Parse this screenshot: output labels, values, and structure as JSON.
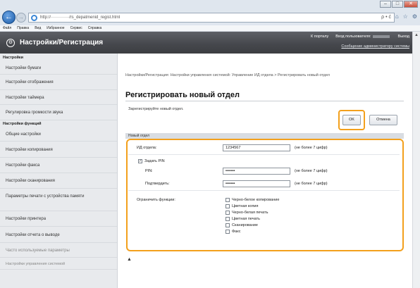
{
  "browser": {
    "url": "http://·············/rs_depatmenid_regist.html",
    "addr_right": "ρ • ć",
    "menu": [
      "Файл",
      "Правка",
      "Вид",
      "Избранное",
      "Сервис",
      "Справка"
    ]
  },
  "header": {
    "title": "Настройки/Регистрация",
    "portal_link": "К порталу",
    "login_label": "Вход пользователя:",
    "logout": "Выход",
    "admin_message": "Сообщение администратору системы"
  },
  "sidebar": {
    "section1": "Настройки",
    "items1": [
      "Настройки бумаги",
      "Настройки отображения",
      "Настройки таймера",
      "Регулировка громкости звука"
    ],
    "section2": "Настройки функций",
    "items2": [
      "Общие настройки",
      "Настройки копирования",
      "Настройки факса",
      "Настройки сканирования",
      "Параметры печати с устройства памяти",
      "Настройки принтера",
      "Настройки отчета о выводе",
      "Часто используемые параметры",
      "Настройки управления системой"
    ]
  },
  "main": {
    "breadcrumb": "Настройки/Регистрация: Настройки управления системой: Управление ИД отдела > Регистрировать новый отдел",
    "title": "Регистрировать новый отдел",
    "instruction": "Зарегистрируйте новый отдел.",
    "ok_label": "OK",
    "cancel_label": "Отмена",
    "section_label": "Новый отдел",
    "dept_id_label": "ИД отдела:",
    "dept_id_value": "1234567",
    "dept_id_hint": "(не более 7 цифр)",
    "set_pin_label": "Задать PIN",
    "pin_label": "PIN:",
    "pin_value": "•••••••",
    "pin_hint": "(не более 7 цифр)",
    "confirm_label": "Подтвердить:",
    "confirm_value": "•••••••",
    "confirm_hint": "(не более 7 цифр)",
    "restrict_label": "Ограничить функции:",
    "restrict_options": [
      "Черно-белое копирование",
      "Цветная копия",
      "Черно-белая печать",
      "Цветная печать",
      "Сканирование",
      "Факс"
    ],
    "top_link": "▲"
  },
  "colors": {
    "highlight": "#f3a01c",
    "header_bg": "#45474c",
    "sidebar_bg": "#e8eaed"
  }
}
